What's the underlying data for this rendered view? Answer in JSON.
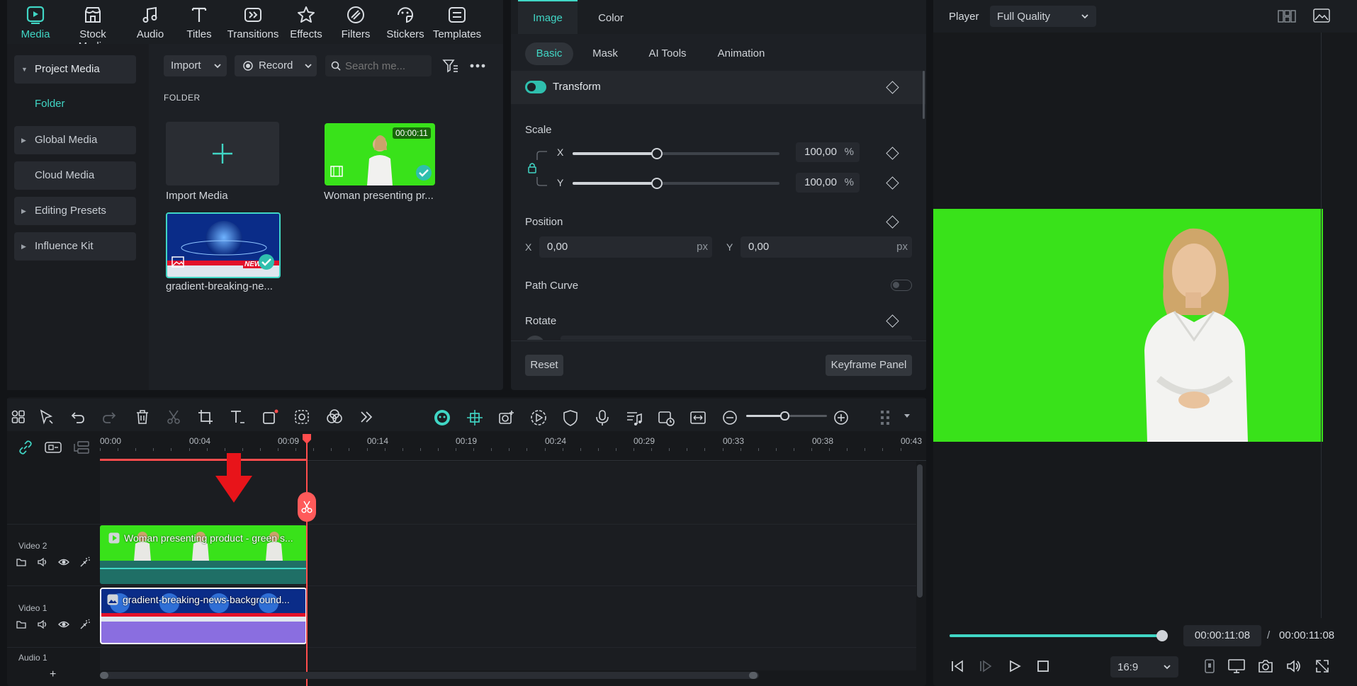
{
  "nav": {
    "tabs": [
      {
        "label": "Media",
        "icon": "media-icon"
      },
      {
        "label": "Stock Media",
        "icon": "stock-media-icon"
      },
      {
        "label": "Audio",
        "icon": "audio-icon"
      },
      {
        "label": "Titles",
        "icon": "titles-icon"
      },
      {
        "label": "Transitions",
        "icon": "transitions-icon"
      },
      {
        "label": "Effects",
        "icon": "effects-icon"
      },
      {
        "label": "Filters",
        "icon": "filters-icon"
      },
      {
        "label": "Stickers",
        "icon": "stickers-icon"
      },
      {
        "label": "Templates",
        "icon": "templates-icon"
      }
    ]
  },
  "sidebar": {
    "project_media": "Project Media",
    "folder": "Folder",
    "global_media": "Global Media",
    "cloud_media": "Cloud Media",
    "editing_presets": "Editing Presets",
    "influence_kit": "Influence Kit"
  },
  "media_toolbar": {
    "import_label": "Import",
    "record_label": "Record",
    "search_placeholder": "Search me..."
  },
  "media": {
    "folder_heading": "FOLDER",
    "import_media": "Import Media",
    "items": [
      {
        "name": "Woman presenting pr...",
        "duration": "00:00:11"
      },
      {
        "name": "gradient-breaking-ne...",
        "badge": "NEWS"
      }
    ]
  },
  "inspector": {
    "tabs": [
      "Image",
      "Color"
    ],
    "subtabs": [
      "Basic",
      "Mask",
      "AI Tools",
      "Animation"
    ],
    "transform": "Transform",
    "scale": "Scale",
    "scale_x_label": "X",
    "scale_y_label": "Y",
    "scale_x": "100,00",
    "scale_y": "100,00",
    "percent": "%",
    "position": "Position",
    "pos_x_label": "X",
    "pos_y_label": "Y",
    "pos_x": "0,00",
    "pos_y": "0,00",
    "px": "px",
    "path_curve": "Path Curve",
    "rotate": "Rotate",
    "reset": "Reset",
    "keyframe_panel": "Keyframe Panel",
    "scale_level_percent": 40
  },
  "player": {
    "label": "Player",
    "quality": "Full Quality",
    "current_time": "00:00:11:08",
    "separator": "/",
    "total_time": "00:00:11:08",
    "aspect": "16:9",
    "progress_percent": 100
  },
  "timeline": {
    "ticks": [
      "00:00",
      "00:04",
      "00:09",
      "00:14",
      "00:19",
      "00:24",
      "00:29",
      "00:33",
      "00:38",
      "00:43"
    ],
    "tracks": [
      {
        "name": "Video 2",
        "clip": "Woman presenting product - green s..."
      },
      {
        "name": "Video 1",
        "clip": "gradient-breaking-news-background..."
      },
      {
        "name": "Audio 1"
      }
    ],
    "add_track": "+"
  },
  "colors": {
    "accent": "#40d6c5",
    "green_screen": "#39e21a",
    "playhead": "#ff4d4d",
    "arrow": "#e8141a",
    "clip_purple": "#8a6ee0"
  }
}
